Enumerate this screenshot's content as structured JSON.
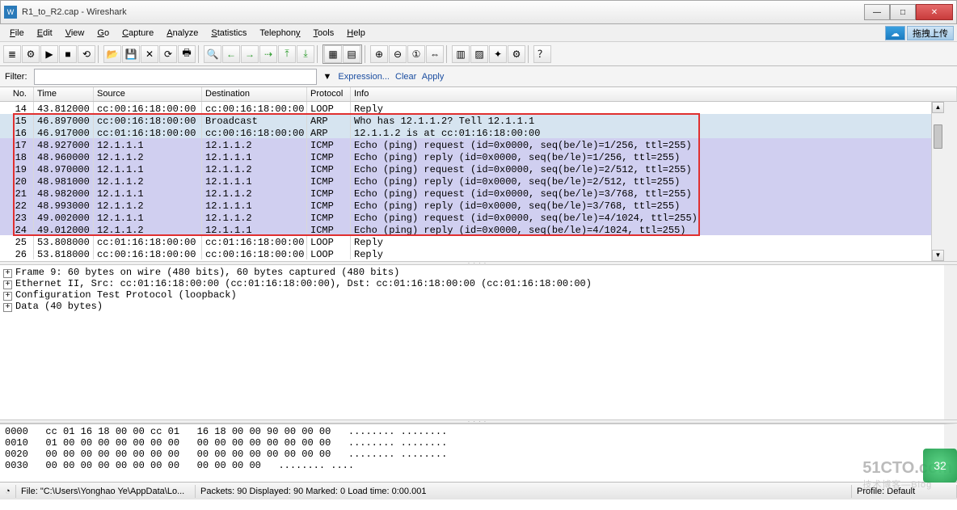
{
  "window": {
    "title": "R1_to_R2.cap - Wireshark"
  },
  "menu": [
    "File",
    "Edit",
    "View",
    "Go",
    "Capture",
    "Analyze",
    "Statistics",
    "Telephony",
    "Tools",
    "Help"
  ],
  "menubar_right": {
    "upload": "拖拽上传"
  },
  "filter": {
    "label": "Filter:",
    "value": "",
    "expression": "Expression...",
    "clear": "Clear",
    "apply": "Apply"
  },
  "columns": {
    "no": "No.",
    "time": "Time",
    "source": "Source",
    "destination": "Destination",
    "protocol": "Protocol",
    "info": "Info"
  },
  "packets": [
    {
      "no": "14",
      "time": "43.812000",
      "src": "cc:00:16:18:00:00",
      "dst": "cc:00:16:18:00:00",
      "proto": "LOOP",
      "info": "Reply",
      "cls": "loop",
      "boxed": false
    },
    {
      "no": "15",
      "time": "46.897000",
      "src": "cc:00:16:18:00:00",
      "dst": "Broadcast",
      "proto": "ARP",
      "info": "Who has 12.1.1.2?  Tell 12.1.1.1",
      "cls": "arp",
      "boxed": true
    },
    {
      "no": "16",
      "time": "46.917000",
      "src": "cc:01:16:18:00:00",
      "dst": "cc:00:16:18:00:00",
      "proto": "ARP",
      "info": "12.1.1.2 is at cc:01:16:18:00:00",
      "cls": "arp",
      "boxed": true
    },
    {
      "no": "17",
      "time": "48.927000",
      "src": "12.1.1.1",
      "dst": "12.1.1.2",
      "proto": "ICMP",
      "info": "Echo (ping) request  (id=0x0000, seq(be/le)=1/256, ttl=255)",
      "cls": "icmp",
      "boxed": true
    },
    {
      "no": "18",
      "time": "48.960000",
      "src": "12.1.1.2",
      "dst": "12.1.1.1",
      "proto": "ICMP",
      "info": "Echo (ping) reply    (id=0x0000, seq(be/le)=1/256, ttl=255)",
      "cls": "icmp",
      "boxed": true
    },
    {
      "no": "19",
      "time": "48.970000",
      "src": "12.1.1.1",
      "dst": "12.1.1.2",
      "proto": "ICMP",
      "info": "Echo (ping) request  (id=0x0000, seq(be/le)=2/512, ttl=255)",
      "cls": "icmp",
      "boxed": true
    },
    {
      "no": "20",
      "time": "48.981000",
      "src": "12.1.1.2",
      "dst": "12.1.1.1",
      "proto": "ICMP",
      "info": "Echo (ping) reply    (id=0x0000, seq(be/le)=2/512, ttl=255)",
      "cls": "icmp",
      "boxed": true
    },
    {
      "no": "21",
      "time": "48.982000",
      "src": "12.1.1.1",
      "dst": "12.1.1.2",
      "proto": "ICMP",
      "info": "Echo (ping) request  (id=0x0000, seq(be/le)=3/768, ttl=255)",
      "cls": "icmp",
      "boxed": true
    },
    {
      "no": "22",
      "time": "48.993000",
      "src": "12.1.1.2",
      "dst": "12.1.1.1",
      "proto": "ICMP",
      "info": "Echo (ping) reply    (id=0x0000, seq(be/le)=3/768, ttl=255)",
      "cls": "icmp",
      "boxed": true
    },
    {
      "no": "23",
      "time": "49.002000",
      "src": "12.1.1.1",
      "dst": "12.1.1.2",
      "proto": "ICMP",
      "info": "Echo (ping) request  (id=0x0000, seq(be/le)=4/1024, ttl=255)",
      "cls": "icmp",
      "boxed": true
    },
    {
      "no": "24",
      "time": "49.012000",
      "src": "12.1.1.2",
      "dst": "12.1.1.1",
      "proto": "ICMP",
      "info": "Echo (ping) reply    (id=0x0000, seq(be/le)=4/1024, ttl=255)",
      "cls": "icmp",
      "boxed": true
    },
    {
      "no": "25",
      "time": "53.808000",
      "src": "cc:01:16:18:00:00",
      "dst": "cc:01:16:18:00:00",
      "proto": "LOOP",
      "info": "Reply",
      "cls": "loop",
      "boxed": false
    },
    {
      "no": "26",
      "time": "53.818000",
      "src": "cc:00:16:18:00:00",
      "dst": "cc:00:16:18:00:00",
      "proto": "LOOP",
      "info": "Reply",
      "cls": "loop",
      "boxed": false
    }
  ],
  "tree": [
    "Frame 9: 60 bytes on wire (480 bits), 60 bytes captured (480 bits)",
    "Ethernet II, Src: cc:01:16:18:00:00 (cc:01:16:18:00:00), Dst: cc:01:16:18:00:00 (cc:01:16:18:00:00)",
    "Configuration Test Protocol (loopback)",
    "Data (40 bytes)"
  ],
  "hex": [
    {
      "off": "0000",
      "b1": "cc 01 16 18 00 00 cc 01",
      "b2": "16 18 00 00 90 00 00 00",
      "a": "........ ........"
    },
    {
      "off": "0010",
      "b1": "01 00 00 00 00 00 00 00",
      "b2": "00 00 00 00 00 00 00 00",
      "a": "........ ........"
    },
    {
      "off": "0020",
      "b1": "00 00 00 00 00 00 00 00",
      "b2": "00 00 00 00 00 00 00 00",
      "a": "........ ........"
    },
    {
      "off": "0030",
      "b1": "00 00 00 00 00 00 00 00",
      "b2": "00 00 00 00",
      "a": "........ ...."
    }
  ],
  "status": {
    "file": "File: \"C:\\Users\\Yonghao Ye\\AppData\\Lo...",
    "stats": "Packets: 90 Displayed: 90 Marked: 0 Load time: 0:00.001",
    "profile": "Profile: Default"
  },
  "watermark": {
    "main": "51CTO.com",
    "sub": "技术博客—Blog",
    "badge": "32"
  }
}
